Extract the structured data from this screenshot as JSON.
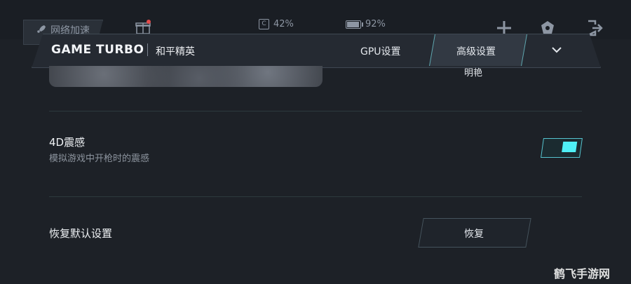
{
  "topbar": {
    "boost_label": "网络加速",
    "cpu_label": "C",
    "cpu_value": "42%",
    "battery_value": "92%",
    "battery_level": 0.92
  },
  "header": {
    "brand": "GAME TURBO",
    "game_name": "和平精英",
    "tabs": [
      {
        "label": "GPU设置",
        "active": false
      },
      {
        "label": "高级设置",
        "active": true
      }
    ]
  },
  "content": {
    "sub_value": "明艳",
    "haptics": {
      "title": "4D震感",
      "description": "模拟游戏中开枪时的震感",
      "enabled": true
    },
    "restore": {
      "title": "恢复默认设置",
      "button_label": "恢复"
    }
  },
  "watermark": "鹤飞手游网",
  "colors": {
    "accent": "#4ff0f6",
    "background": "#1d2127"
  }
}
